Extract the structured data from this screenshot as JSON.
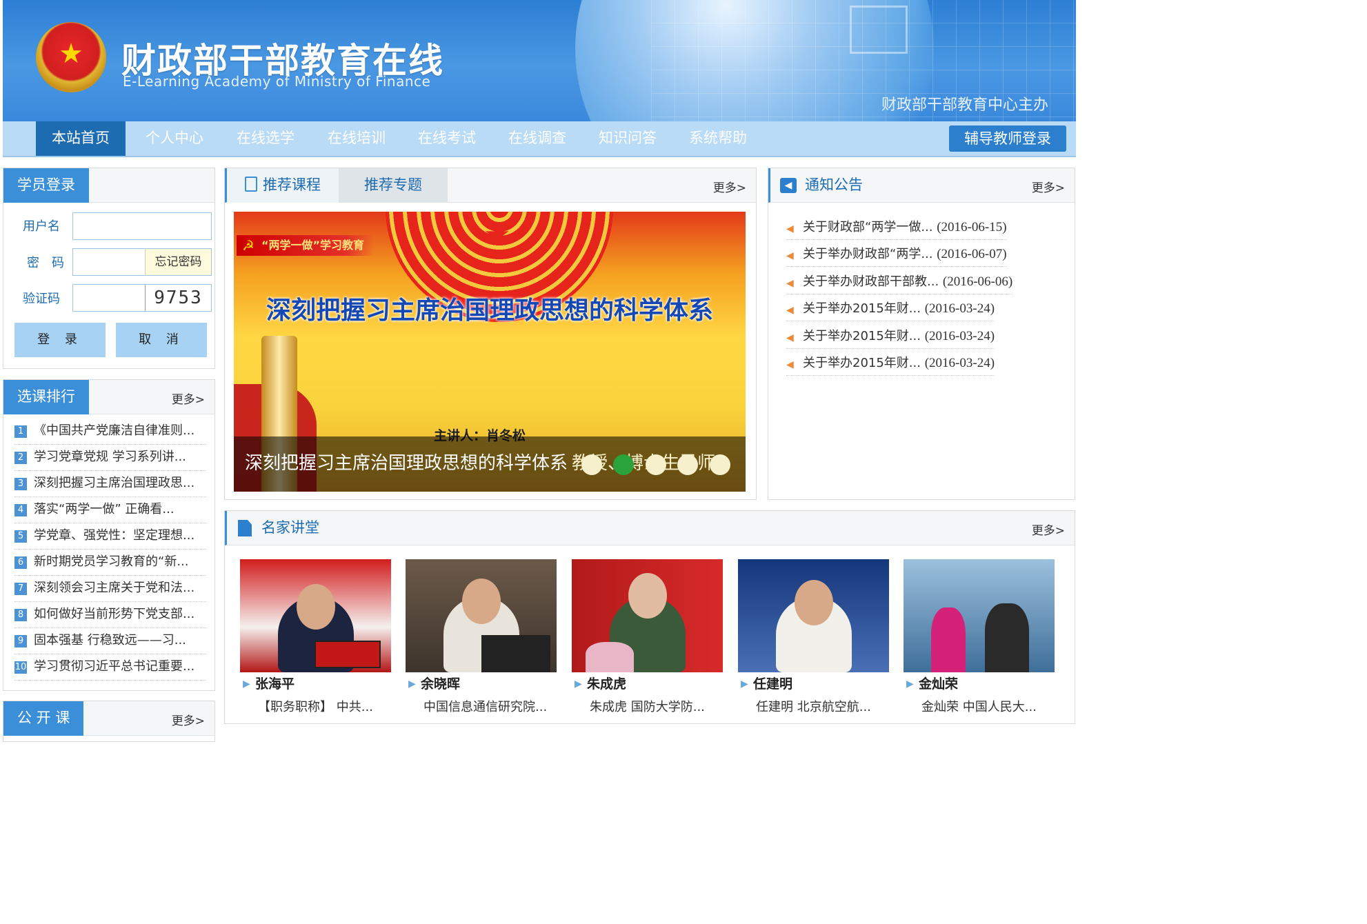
{
  "header": {
    "site_title": "财政部干部教育在线",
    "site_subtitle": "E-Learning Academy of Ministry of Finance",
    "sponsor": "财政部干部教育中心主办"
  },
  "nav": {
    "items": [
      "本站首页",
      "个人中心",
      "在线选学",
      "在线培训",
      "在线考试",
      "在线调查",
      "知识问答",
      "系统帮助"
    ],
    "active_index": 0,
    "tutor_login": "辅导教师登录"
  },
  "login": {
    "title": "学员登录",
    "username_label": "用户名",
    "password_label": "密　码",
    "forgot_label": "忘记密码",
    "captcha_label": "验证码",
    "captcha_code": "9753",
    "login_button": "登 录",
    "cancel_button": "取 消"
  },
  "ranking": {
    "title": "选课排行",
    "more": "更多>",
    "items": [
      {
        "num": "1",
        "title": "《中国共产党廉洁自律准则..."
      },
      {
        "num": "2",
        "title": "学习党章党规 学习系列讲..."
      },
      {
        "num": "3",
        "title": "深刻把握习主席治国理政思..."
      },
      {
        "num": "4",
        "title": "落实“两学一做” 正确看..."
      },
      {
        "num": "5",
        "title": "学党章、强党性：坚定理想..."
      },
      {
        "num": "6",
        "title": "新时期党员学习教育的“新..."
      },
      {
        "num": "7",
        "title": "深刻领会习主席关于党和法..."
      },
      {
        "num": "8",
        "title": "如何做好当前形势下党支部..."
      },
      {
        "num": "9",
        "title": "固本强基 行稳致远——习..."
      },
      {
        "num": "10",
        "title": "学习贯彻习近平总书记重要..."
      }
    ]
  },
  "public_course": {
    "title": "公 开 课",
    "more": "更多>"
  },
  "recommend": {
    "tab_courses": "推荐课程",
    "tab_topics": "推荐专题",
    "more": "更多>",
    "slide": {
      "badge": "“两学一做”学习教育",
      "heading": "深刻把握习主席治国理政思想的科学体系",
      "speaker": "主讲人：肖冬松",
      "caption": "深刻把握习主席治国理政思想的科学体系",
      "caption_suffix": "教授、博士生导师",
      "dot_count": 5,
      "active_dot": 1
    }
  },
  "notice": {
    "title": "通知公告",
    "more": "更多>",
    "items": [
      {
        "title": "关于财政部“两学一做...",
        "date": "(2016-06-15)"
      },
      {
        "title": "关于举办财政部“两学...",
        "date": "(2016-06-07)"
      },
      {
        "title": "关于举办财政部干部教...",
        "date": "(2016-06-06)"
      },
      {
        "title": "关于举办2015年财...",
        "date": "(2016-03-24)"
      },
      {
        "title": "关于举办2015年财...",
        "date": "(2016-03-24)"
      },
      {
        "title": "关于举办2015年财...",
        "date": "(2016-03-24)"
      }
    ]
  },
  "lecture": {
    "title": "名家讲堂",
    "more": "更多>",
    "speakers": [
      {
        "name": "张海平",
        "desc": "【职务职称】 中共..."
      },
      {
        "name": "余晓晖",
        "desc": "中国信息通信研究院..."
      },
      {
        "name": "朱成虎",
        "desc": "朱成虎 国防大学防..."
      },
      {
        "name": "任建明",
        "desc": "任建明 北京航空航..."
      },
      {
        "name": "金灿荣",
        "desc": "金灿荣 中国人民大..."
      }
    ]
  }
}
